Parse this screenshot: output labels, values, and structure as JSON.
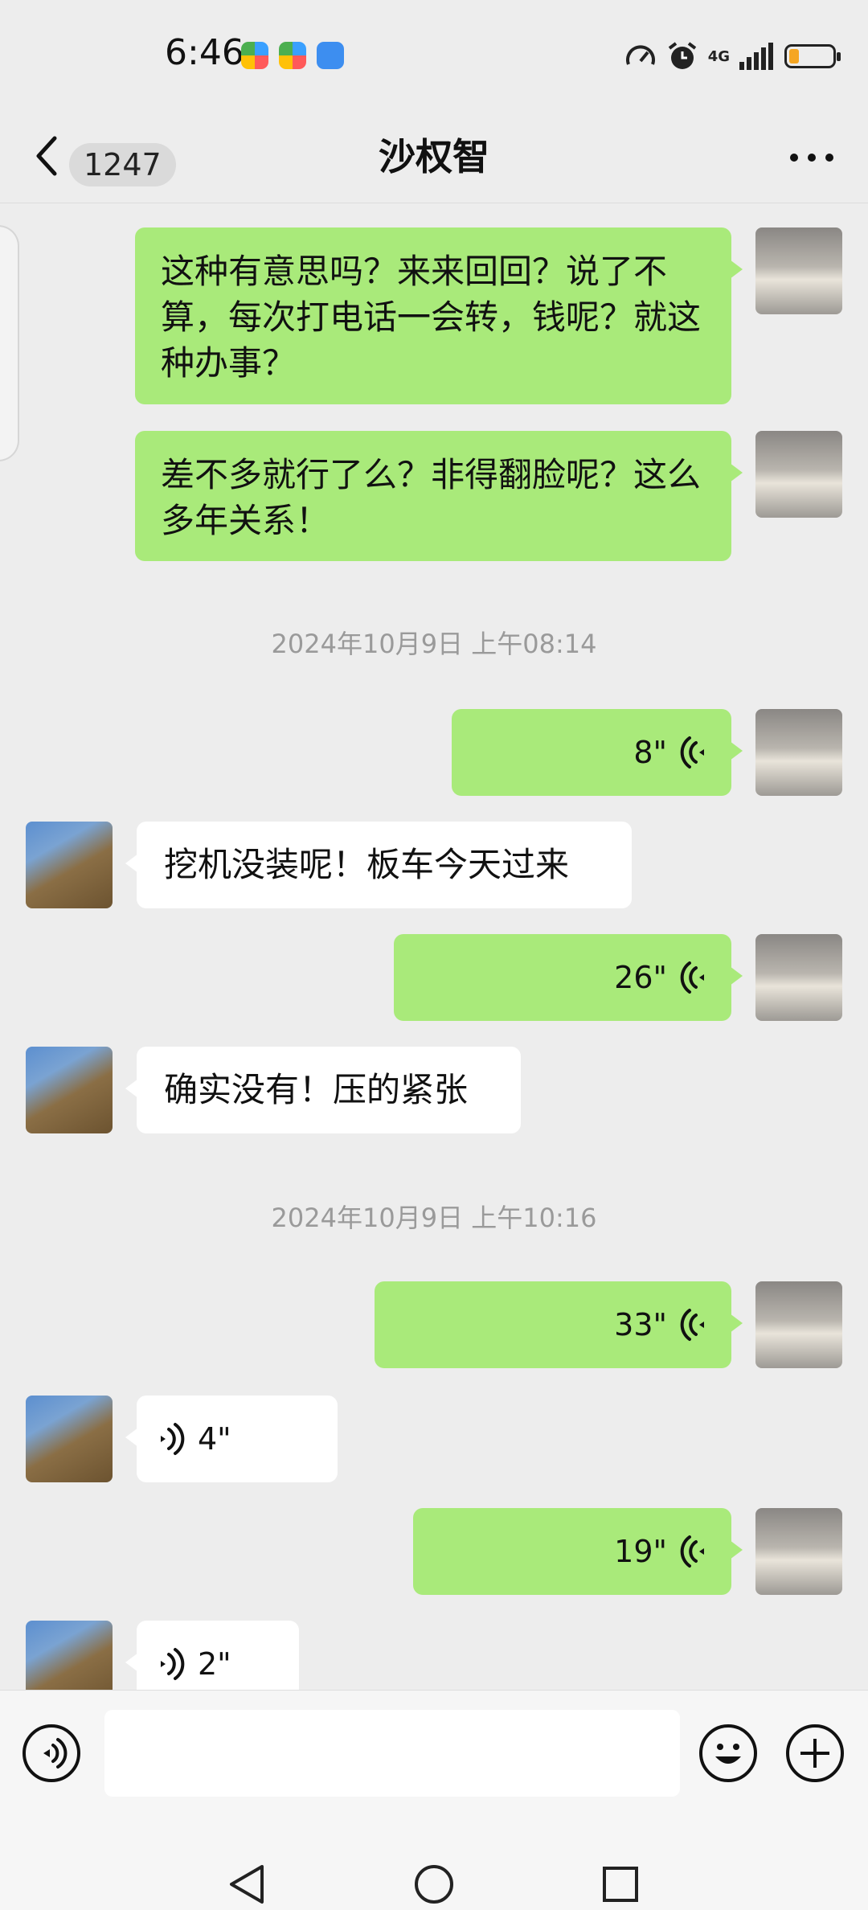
{
  "status_bar": {
    "time": "6:46",
    "network": "4G",
    "battery_color": "#f5a623"
  },
  "header": {
    "back_icon": "chevron-left-icon",
    "unread_count": "1247",
    "title": "沙权智",
    "more_icon": "more-dots-icon"
  },
  "messages": [
    {
      "side": "me",
      "type": "text",
      "text": "这种有意思吗？来来回回？说了不算，每次打电话一会转，钱呢？就这种办事？"
    },
    {
      "side": "me",
      "type": "text",
      "text": "差不多就行了么？非得翻脸呢？这么多年关系！"
    },
    {
      "type": "timestamp",
      "text": "2024年10月9日 上午08:14"
    },
    {
      "side": "me",
      "type": "voice",
      "duration": "8\""
    },
    {
      "side": "other",
      "type": "text",
      "text": "挖机没装呢！板车今天过来"
    },
    {
      "side": "me",
      "type": "voice",
      "duration": "26\""
    },
    {
      "side": "other",
      "type": "text",
      "text": "确实没有！压的紧张"
    },
    {
      "type": "timestamp",
      "text": "2024年10月9日 上午10:16"
    },
    {
      "side": "me",
      "type": "voice",
      "duration": "33\""
    },
    {
      "side": "other",
      "type": "voice",
      "duration": "4\""
    },
    {
      "side": "me",
      "type": "voice",
      "duration": "19\""
    },
    {
      "side": "other",
      "type": "voice",
      "duration": "2\""
    }
  ],
  "input_bar": {
    "voice_icon": "voice-input-icon",
    "text_value": "",
    "emoji_icon": "emoji-icon",
    "plus_icon": "plus-icon"
  },
  "nav_bar": {
    "back_icon": "nav-back-icon",
    "home_icon": "nav-home-icon",
    "recents_icon": "nav-recents-icon"
  },
  "colors": {
    "my_bubble": "#a9ea7a",
    "other_bubble": "#ffffff",
    "background": "#ededed"
  }
}
